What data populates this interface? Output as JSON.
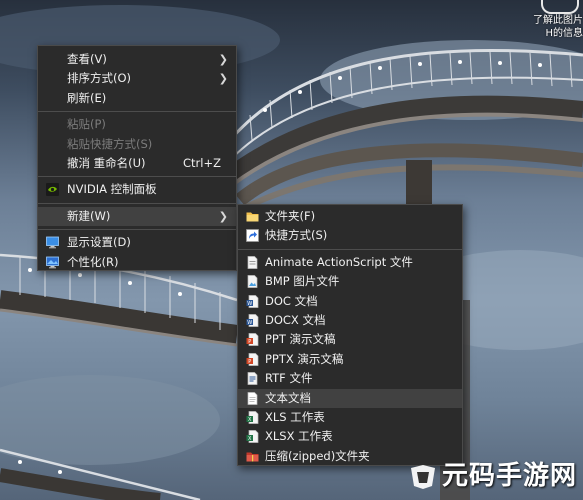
{
  "notification": {
    "line1": "了解此图片",
    "line2": "H的信息"
  },
  "context_menu": {
    "items": [
      {
        "label": "查看(V)",
        "has_submenu": true
      },
      {
        "label": "排序方式(O)",
        "has_submenu": true
      },
      {
        "label": "刷新(E)"
      },
      {
        "label": "粘贴(P)",
        "disabled": true
      },
      {
        "label": "粘贴快捷方式(S)",
        "disabled": true
      },
      {
        "label": "撤消 重命名(U)",
        "shortcut": "Ctrl+Z"
      },
      {
        "label": "NVIDIA 控制面板",
        "icon": "nvidia-icon"
      },
      {
        "label": "新建(W)",
        "has_submenu": true
      },
      {
        "label": "显示设置(D)",
        "icon": "display-settings-icon"
      },
      {
        "label": "个性化(R)",
        "icon": "personalize-icon"
      }
    ]
  },
  "new_submenu": {
    "items": [
      {
        "label": "文件夹(F)",
        "icon": "folder-icon"
      },
      {
        "label": "快捷方式(S)",
        "icon": "shortcut-icon"
      },
      {
        "label": "Animate ActionScript 文件",
        "icon": "actionscript-file-icon"
      },
      {
        "label": "BMP 图片文件",
        "icon": "bmp-file-icon"
      },
      {
        "label": "DOC 文档",
        "icon": "doc-file-icon"
      },
      {
        "label": "DOCX 文档",
        "icon": "docx-file-icon"
      },
      {
        "label": "PPT 演示文稿",
        "icon": "ppt-file-icon"
      },
      {
        "label": "PPTX 演示文稿",
        "icon": "pptx-file-icon"
      },
      {
        "label": "RTF 文件",
        "icon": "rtf-file-icon"
      },
      {
        "label": "文本文档",
        "icon": "text-file-icon"
      },
      {
        "label": "XLS 工作表",
        "icon": "xls-file-icon"
      },
      {
        "label": "XLSX 工作表",
        "icon": "xlsx-file-icon"
      },
      {
        "label": "压缩(zipped)文件夹",
        "icon": "zip-folder-icon"
      }
    ]
  },
  "watermark": {
    "text": "元码手游网"
  },
  "colors": {
    "menu_bg": "#2b2b2b",
    "menu_highlight": "#414141",
    "text": "#f0f0f0",
    "disabled_text": "#7c7c7c",
    "nvidia_green": "#76b900",
    "word_blue": "#2b5797",
    "ppt_orange": "#d24726",
    "excel_green": "#217346",
    "folder_yellow": "#f2c14e"
  }
}
